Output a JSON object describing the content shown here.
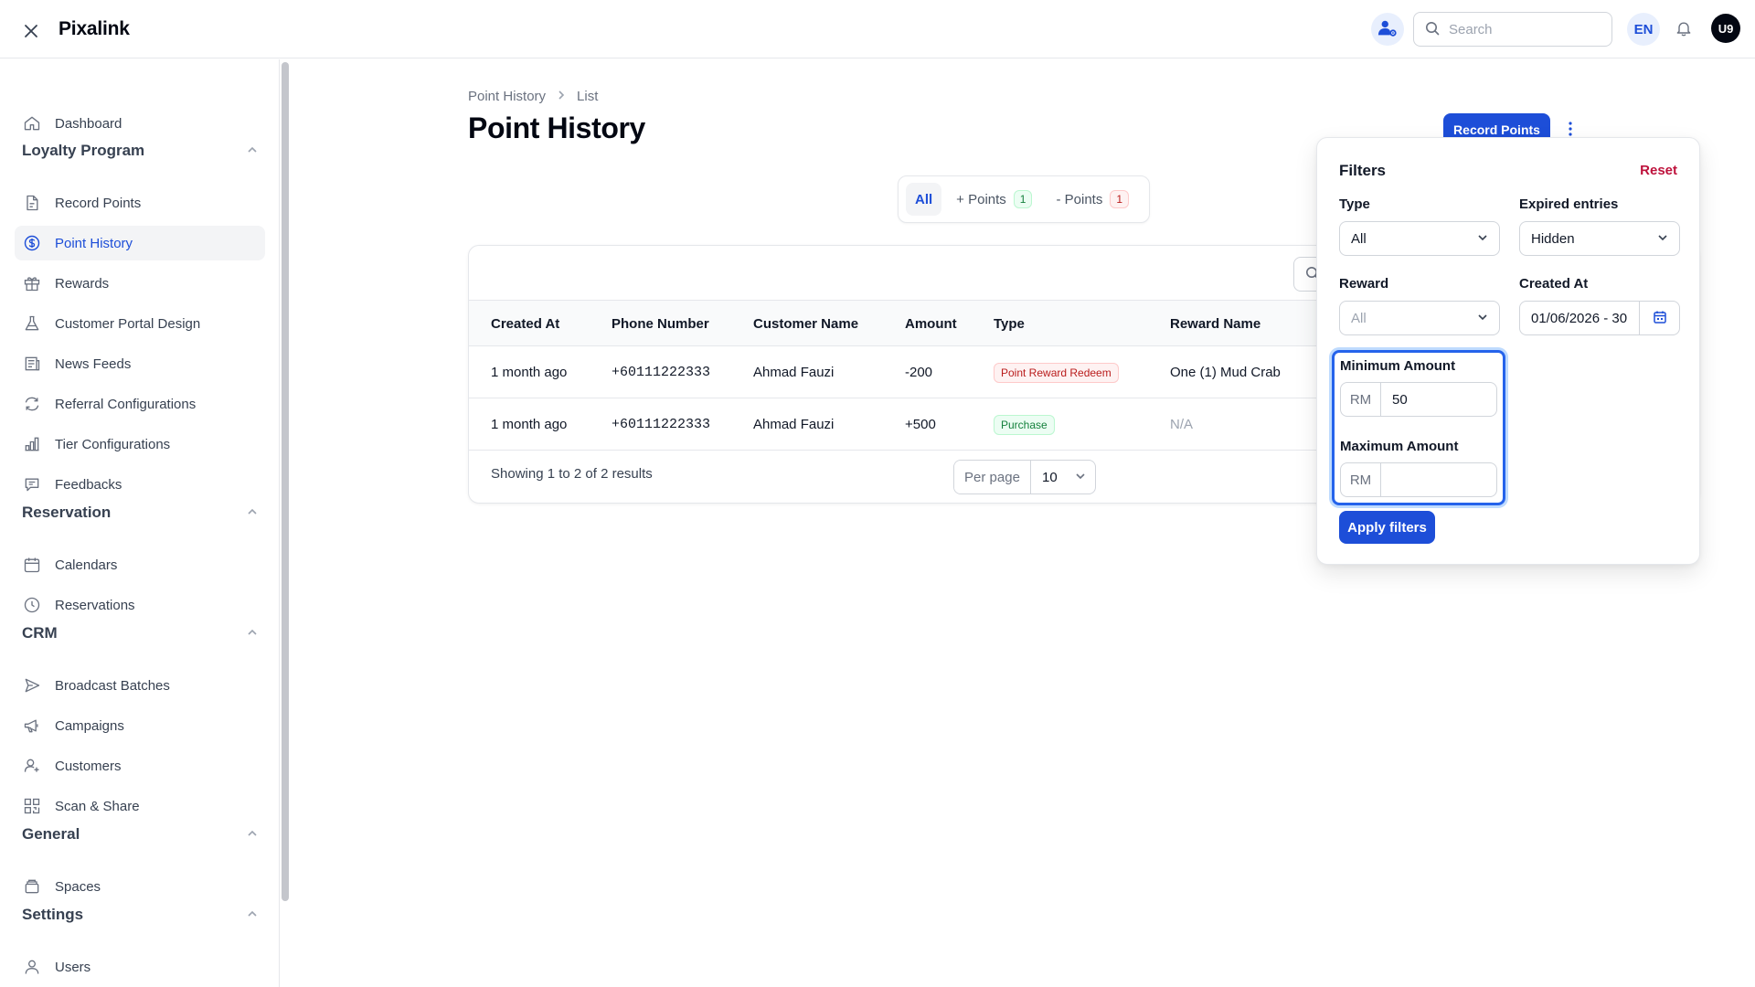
{
  "app": {
    "brand": "Pixalink"
  },
  "header": {
    "search_placeholder": "Search",
    "language": "EN",
    "avatar_initials": "U9"
  },
  "sidebar": {
    "dashboard": "Dashboard",
    "groups": {
      "loyalty": "Loyalty Program",
      "reservation": "Reservation",
      "crm": "CRM",
      "general": "General",
      "settings": "Settings"
    },
    "items": {
      "record_points": "Record Points",
      "point_history": "Point History",
      "rewards": "Rewards",
      "customer_portal_design": "Customer Portal Design",
      "news_feeds": "News Feeds",
      "referral_configurations": "Referral Configurations",
      "tier_configurations": "Tier Configurations",
      "feedbacks": "Feedbacks",
      "calendars": "Calendars",
      "reservations": "Reservations",
      "broadcast_batches": "Broadcast Batches",
      "campaigns": "Campaigns",
      "customers": "Customers",
      "scan_share": "Scan & Share",
      "spaces": "Spaces",
      "users": "Users"
    }
  },
  "page": {
    "breadcrumb": [
      "Point History",
      "List"
    ],
    "title": "Point History",
    "record_points_button": "Record Points"
  },
  "tabs": [
    {
      "label": "All",
      "count": ""
    },
    {
      "label": "+ Points",
      "count": "1"
    },
    {
      "label": "- Points",
      "count": "1"
    }
  ],
  "table": {
    "columns": [
      "Created At",
      "Phone Number",
      "Customer Name",
      "Amount",
      "Type",
      "Reward Name"
    ],
    "rows": [
      {
        "created_at": "1 month ago",
        "phone": "+60111222333",
        "customer": "Ahmad Fauzi",
        "amount": "-200",
        "type": "Point Reward Redeem",
        "reward": "One (1) Mud Crab"
      },
      {
        "created_at": "1 month ago",
        "phone": "+60111222333",
        "customer": "Ahmad Fauzi",
        "amount": "+500",
        "type": "Purchase",
        "reward": "N/A"
      }
    ],
    "footer": "Showing 1 to 2 of 2 results",
    "per_page_label": "Per page",
    "per_page_value": "10"
  },
  "filters": {
    "title": "Filters",
    "reset": "Reset",
    "type_label": "Type",
    "type_value": "All",
    "expired_label": "Expired entries",
    "expired_value": "Hidden",
    "reward_label": "Reward",
    "reward_placeholder": "All",
    "created_at_label": "Created At",
    "created_at_value": "01/06/2026 - 30",
    "min_amount_label": "Minimum Amount",
    "min_amount_prefix": "RM",
    "min_amount_value": "50",
    "max_amount_label": "Maximum Amount",
    "max_amount_prefix": "RM",
    "max_amount_value": "",
    "apply_button": "Apply filters"
  },
  "colors": {
    "primary": "#1d4ed8",
    "danger": "#be123c",
    "success": "#15803d"
  }
}
